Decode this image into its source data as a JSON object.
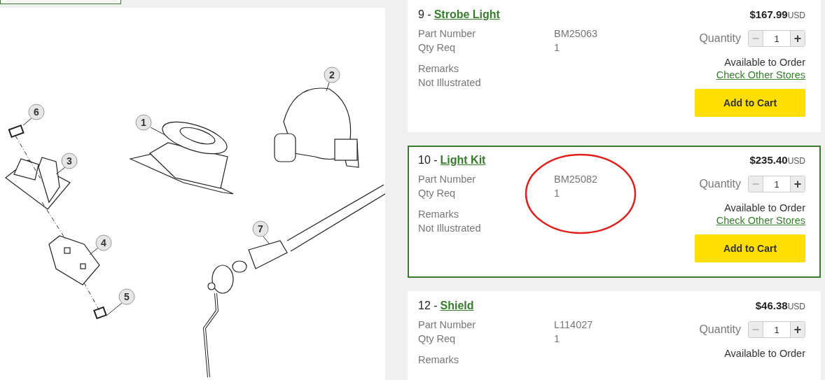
{
  "diagram": {
    "callouts": [
      {
        "label": "1"
      },
      {
        "label": "2"
      },
      {
        "label": "3"
      },
      {
        "label": "4"
      },
      {
        "label": "5"
      },
      {
        "label": "6"
      },
      {
        "label": "7"
      }
    ]
  },
  "parts": [
    {
      "number": "9 -",
      "name": "Strobe Light",
      "price": "$167.99",
      "currency": "USD",
      "selected": false,
      "circled": false,
      "fields": [
        {
          "label": "Part Number",
          "value": "BM25063"
        },
        {
          "label": "Qty Req",
          "value": "1"
        }
      ],
      "remarks_label": "Remarks",
      "remarks": "Not Illustrated",
      "quantity_label": "Quantity",
      "quantity": "1",
      "minus": "−",
      "plus": "+",
      "availability": "Available to Order",
      "stores_link": "Check Other Stores",
      "cart_button": "Add to Cart"
    },
    {
      "number": "10 -",
      "name": "Light Kit",
      "price": "$235.40",
      "currency": "USD",
      "selected": true,
      "circled": true,
      "fields": [
        {
          "label": "Part Number",
          "value": "BM25082"
        },
        {
          "label": "Qty Req",
          "value": "1"
        }
      ],
      "remarks_label": "Remarks",
      "remarks": "Not Illustrated",
      "quantity_label": "Quantity",
      "quantity": "1",
      "minus": "−",
      "plus": "+",
      "availability": "Available to Order",
      "stores_link": "Check Other Stores",
      "cart_button": "Add to Cart"
    },
    {
      "number": "12 -",
      "name": "Shield",
      "price": "$46.38",
      "currency": "USD",
      "selected": false,
      "circled": false,
      "fields": [
        {
          "label": "Part Number",
          "value": "L114027"
        },
        {
          "label": "Qty Req",
          "value": "1"
        }
      ],
      "remarks_label": "Remarks",
      "quantity_label": "Quantity",
      "quantity": "1",
      "minus": "−",
      "plus": "+",
      "availability": "Available to Order"
    }
  ]
}
